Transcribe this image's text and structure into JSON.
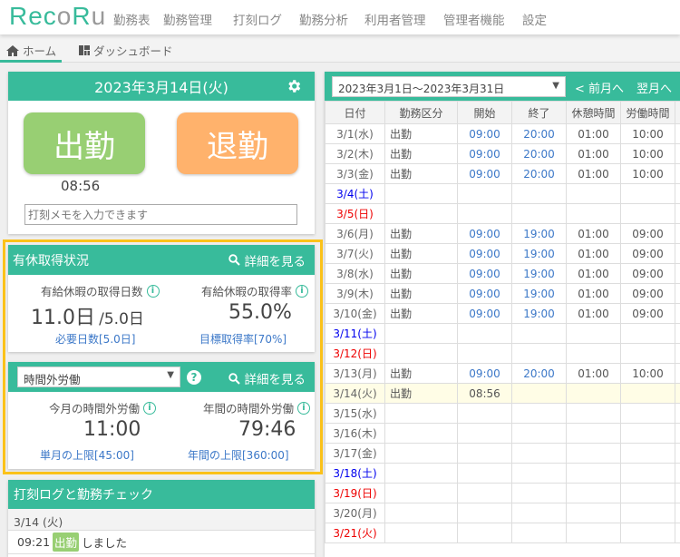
{
  "header": {
    "logo": "RecoRu",
    "nav": [
      "勤務表",
      "勤務管理",
      "打刻ログ",
      "勤務分析",
      "利用者管理",
      "管理者機能",
      "設定"
    ]
  },
  "subnav": {
    "tabs": [
      {
        "label": "ホーム",
        "icon": "home-icon"
      },
      {
        "label": "ダッシュボード",
        "icon": "dashboard-icon"
      }
    ]
  },
  "colors": {
    "accent": "#38bb9b",
    "clock_in": "#98cf73",
    "clock_out": "#ffb26c",
    "highlight": "#fbc21a",
    "link": "#3c78c8",
    "saturday": "#0000ee",
    "sunday": "#ee0000",
    "weekday": "#666666",
    "today_row": "#fffde6"
  },
  "punch": {
    "date": "2023年3月14日(火)",
    "clock_in": "出勤",
    "clock_out": "退勤",
    "clock_in_time": "08:56",
    "memo_placeholder": "打刻メモを入力できます"
  },
  "leave": {
    "title": "有休取得状況",
    "detail": "詳細を見る",
    "days_label": "有給休暇の取得日数",
    "days_value": "11.0日",
    "days_total": "/5.0日",
    "days_req": "必要日数[5.0日]",
    "rate_label": "有給休暇の取得率",
    "rate_value": "55.0%",
    "rate_target": "目標取得率[70%]"
  },
  "overtime": {
    "select": "時間外労働",
    "detail": "詳細を見る",
    "month_label": "今月の時間外労働",
    "month_value": "11:00",
    "month_limit": "単月の上限[45:00]",
    "year_label": "年間の時間外労働",
    "year_value": "79:46",
    "year_limit": "年間の上限[360:00]"
  },
  "log": {
    "title": "打刻ログと勤務チェック",
    "date": "3/14 (火)",
    "time": "09:21",
    "badge": "出勤",
    "text": "しました"
  },
  "timesheet": {
    "range": "2023年3月1日～2023年3月31日",
    "prev": "< 前月へ",
    "next": "翌月へ",
    "columns": [
      "日付",
      "勤務区分",
      "開始",
      "終了",
      "休憩時間",
      "労働時間",
      ""
    ],
    "rows": [
      {
        "date": "3/1(水)",
        "type": "weekday",
        "kind": "出勤",
        "start": "09:00",
        "end": "20:00",
        "break": "01:00",
        "work": "10:00"
      },
      {
        "date": "3/2(木)",
        "type": "weekday",
        "kind": "出勤",
        "start": "09:00",
        "end": "20:00",
        "break": "01:00",
        "work": "10:00"
      },
      {
        "date": "3/3(金)",
        "type": "weekday",
        "kind": "出勤",
        "start": "09:00",
        "end": "20:00",
        "break": "01:00",
        "work": "10:00"
      },
      {
        "date": "3/4(土)",
        "type": "saturday",
        "kind": "",
        "start": "",
        "end": "",
        "break": "",
        "work": ""
      },
      {
        "date": "3/5(日)",
        "type": "sunday",
        "kind": "",
        "start": "",
        "end": "",
        "break": "",
        "work": ""
      },
      {
        "date": "3/6(月)",
        "type": "weekday",
        "kind": "出勤",
        "start": "09:00",
        "end": "19:00",
        "break": "01:00",
        "work": "09:00"
      },
      {
        "date": "3/7(火)",
        "type": "weekday",
        "kind": "出勤",
        "start": "09:00",
        "end": "19:00",
        "break": "01:00",
        "work": "09:00"
      },
      {
        "date": "3/8(水)",
        "type": "weekday",
        "kind": "出勤",
        "start": "09:00",
        "end": "19:00",
        "break": "01:00",
        "work": "09:00"
      },
      {
        "date": "3/9(木)",
        "type": "weekday",
        "kind": "出勤",
        "start": "09:00",
        "end": "19:00",
        "break": "01:00",
        "work": "09:00"
      },
      {
        "date": "3/10(金)",
        "type": "weekday",
        "kind": "出勤",
        "start": "09:00",
        "end": "19:00",
        "break": "01:00",
        "work": "09:00"
      },
      {
        "date": "3/11(土)",
        "type": "saturday",
        "kind": "",
        "start": "",
        "end": "",
        "break": "",
        "work": ""
      },
      {
        "date": "3/12(日)",
        "type": "sunday",
        "kind": "",
        "start": "",
        "end": "",
        "break": "",
        "work": ""
      },
      {
        "date": "3/13(月)",
        "type": "weekday",
        "kind": "出勤",
        "start": "09:00",
        "end": "20:00",
        "break": "01:00",
        "work": "10:00"
      },
      {
        "date": "3/14(火)",
        "type": "weekday",
        "today": true,
        "kind": "出勤",
        "start": "08:56",
        "end": "",
        "break": "",
        "work": ""
      },
      {
        "date": "3/15(水)",
        "type": "weekday",
        "kind": "",
        "start": "",
        "end": "",
        "break": "",
        "work": ""
      },
      {
        "date": "3/16(木)",
        "type": "weekday",
        "kind": "",
        "start": "",
        "end": "",
        "break": "",
        "work": ""
      },
      {
        "date": "3/17(金)",
        "type": "weekday",
        "kind": "",
        "start": "",
        "end": "",
        "break": "",
        "work": ""
      },
      {
        "date": "3/18(土)",
        "type": "saturday",
        "kind": "",
        "start": "",
        "end": "",
        "break": "",
        "work": ""
      },
      {
        "date": "3/19(日)",
        "type": "sunday",
        "kind": "",
        "start": "",
        "end": "",
        "break": "",
        "work": ""
      },
      {
        "date": "3/20(月)",
        "type": "weekday",
        "kind": "",
        "start": "",
        "end": "",
        "break": "",
        "work": ""
      },
      {
        "date": "3/21(火)",
        "type": "sunday",
        "kind": "",
        "start": "",
        "end": "",
        "break": "",
        "work": ""
      }
    ]
  }
}
